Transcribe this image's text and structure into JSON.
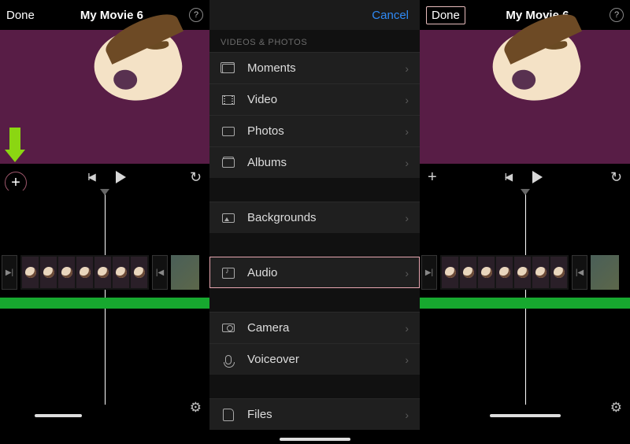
{
  "panel_left": {
    "done": "Done",
    "title": "My Movie 6",
    "help": "?",
    "add": "+",
    "transport": {
      "skip_start": "I◀",
      "undo": "↺"
    }
  },
  "picker": {
    "cancel": "Cancel",
    "section1": "VIDEOS & PHOTOS",
    "moments": "Moments",
    "video": "Video",
    "photos": "Photos",
    "albums": "Albums",
    "backgrounds": "Backgrounds",
    "audio": "Audio",
    "camera": "Camera",
    "voiceover": "Voiceover",
    "files": "Files",
    "chevron": "›"
  },
  "panel_right": {
    "done": "Done",
    "title": "My Movie 6",
    "help": "?",
    "add": "+",
    "transport": {
      "skip_start": "I◀",
      "undo": "↺"
    }
  },
  "gear": "⚙"
}
